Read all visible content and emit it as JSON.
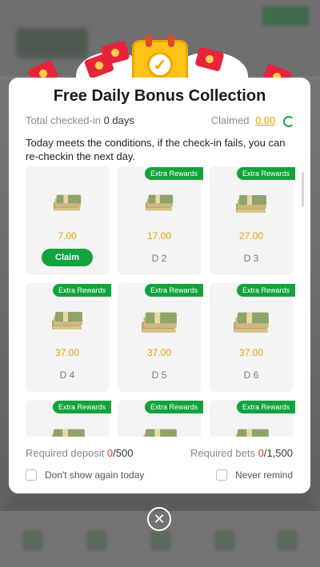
{
  "modal": {
    "title": "Free Daily Bonus Collection",
    "total_checked_label": "Total checked-in",
    "total_checked_value": "0 days",
    "claimed_label": "Claimed",
    "claimed_value": "0.00",
    "description": "Today meets the conditions, if the check-in fails, you can re-checkin the next day.",
    "required_deposit_label": "Required deposit",
    "required_deposit_current": "0",
    "required_deposit_total": "/500",
    "required_bets_label": "Required bets",
    "required_bets_current": "0",
    "required_bets_total": "/1,500",
    "dont_show_label": "Don't show again today",
    "never_remind_label": "Never remind"
  },
  "days": [
    {
      "amount": "7.00",
      "day_label": "",
      "badge": "",
      "claim_label": "Claim"
    },
    {
      "amount": "17.00",
      "day_label": "D 2",
      "badge": "Extra Rewards"
    },
    {
      "amount": "27.00",
      "day_label": "D 3",
      "badge": "Extra Rewards"
    },
    {
      "amount": "37.00",
      "day_label": "D 4",
      "badge": "Extra Rewards"
    },
    {
      "amount": "37.00",
      "day_label": "D 5",
      "badge": "Extra Rewards"
    },
    {
      "amount": "37.00",
      "day_label": "D 6",
      "badge": "Extra Rewards"
    },
    {
      "amount": "",
      "day_label": "",
      "badge": "Extra Rewards"
    },
    {
      "amount": "",
      "day_label": "",
      "badge": "Extra Rewards"
    },
    {
      "amount": "",
      "day_label": "",
      "badge": "Extra Rewards"
    }
  ],
  "colors": {
    "accent_green": "#12a33c",
    "amount_gold": "#e6a200",
    "required_red": "#e23b2e"
  },
  "icons": {
    "close": "close-icon",
    "refresh": "refresh-icon",
    "money": "money-stack-icon",
    "calendar": "calendar-check-icon",
    "envelope": "red-envelope-icon"
  }
}
